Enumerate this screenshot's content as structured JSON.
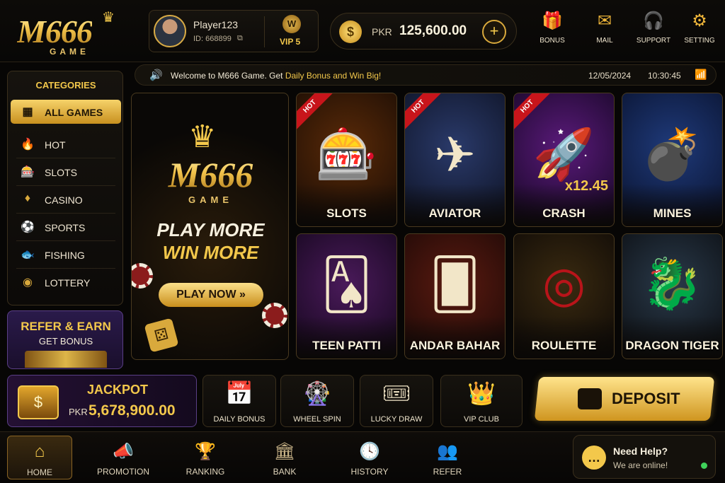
{
  "brand": {
    "logo_text": "M666",
    "logo_sub": "GAME"
  },
  "user": {
    "name": "Player123",
    "id_label": "ID: 668899",
    "vip_badge": "W",
    "vip_label": "VIP 5"
  },
  "balance": {
    "currency": "PKR",
    "amount": "125,600.00",
    "add_label": "+"
  },
  "header_buttons": [
    {
      "label": "BONUS",
      "icon": "gift-icon"
    },
    {
      "label": "MAIL",
      "icon": "mail-icon"
    },
    {
      "label": "SUPPORT",
      "icon": "headset-icon"
    },
    {
      "label": "SETTING",
      "icon": "gear-icon"
    }
  ],
  "ticker": {
    "message": "Welcome to M666 Game. Get ",
    "highlight": "Daily Bonus and Win Big!",
    "date": "12/05/2024",
    "time": "10:30:45"
  },
  "sidebar": {
    "title": "CATEGORIES",
    "items": [
      {
        "label": "ALL GAMES",
        "icon": "grid-icon",
        "active": true
      },
      {
        "label": "HOT",
        "icon": "flame-icon"
      },
      {
        "label": "SLOTS",
        "icon": "slot-machine-icon"
      },
      {
        "label": "CASINO",
        "icon": "casino-chip-icon"
      },
      {
        "label": "SPORTS",
        "icon": "football-icon"
      },
      {
        "label": "FISHING",
        "icon": "fish-icon"
      },
      {
        "label": "LOTTERY",
        "icon": "lottery-ball-icon"
      }
    ]
  },
  "refer": {
    "title": "REFER & EARN",
    "subtitle": "GET BONUS"
  },
  "banner": {
    "logo_text": "M666",
    "logo_sub": "GAME",
    "line1": "PLAY MORE",
    "line2": "WIN MORE",
    "button": "PLAY NOW »"
  },
  "games": [
    {
      "name": "SLOTS",
      "badge": "HOT",
      "icon": "slot-machine-icon"
    },
    {
      "name": "AVIATOR",
      "badge": "HOT",
      "icon": "airplane-icon"
    },
    {
      "name": "CRASH",
      "badge": "HOT",
      "icon": "rocket-icon",
      "multiplier": "x12.45"
    },
    {
      "name": "MINES",
      "icon": "bomb-icon"
    },
    {
      "name": "TEEN PATTI",
      "icon": "playing-cards-icon"
    },
    {
      "name": "ANDAR BAHAR",
      "icon": "card-backs-icon"
    },
    {
      "name": "ROULETTE",
      "icon": "roulette-wheel-icon"
    },
    {
      "name": "DRAGON TIGER",
      "icon": "dragon-tiger-icon"
    }
  ],
  "jackpot": {
    "title": "JACKPOT",
    "currency": "PKR",
    "amount": "5,678,900.00"
  },
  "quick_actions": [
    {
      "label": "DAILY BONUS",
      "icon": "calendar-gift-icon"
    },
    {
      "label": "WHEEL SPIN",
      "icon": "prize-wheel-icon"
    },
    {
      "label": "LUCKY DRAW",
      "icon": "ticket-icon"
    },
    {
      "label": "VIP CLUB",
      "icon": "vip-crest-icon"
    }
  ],
  "deposit": {
    "label": "DEPOSIT"
  },
  "bottom_nav": [
    {
      "label": "HOME",
      "icon": "home-icon",
      "active": true
    },
    {
      "label": "PROMOTION",
      "icon": "megaphone-icon"
    },
    {
      "label": "RANKING",
      "icon": "trophy-icon"
    },
    {
      "label": "BANK",
      "icon": "bank-icon"
    },
    {
      "label": "HISTORY",
      "icon": "history-clock-icon"
    },
    {
      "label": "REFER",
      "icon": "users-icon"
    }
  ],
  "help": {
    "title": "Need Help?",
    "status": "We are online!"
  },
  "colors": {
    "gold": "#f3c84b",
    "background": "#070605",
    "hot_badge": "#c8151b",
    "online": "#3fd15a"
  }
}
